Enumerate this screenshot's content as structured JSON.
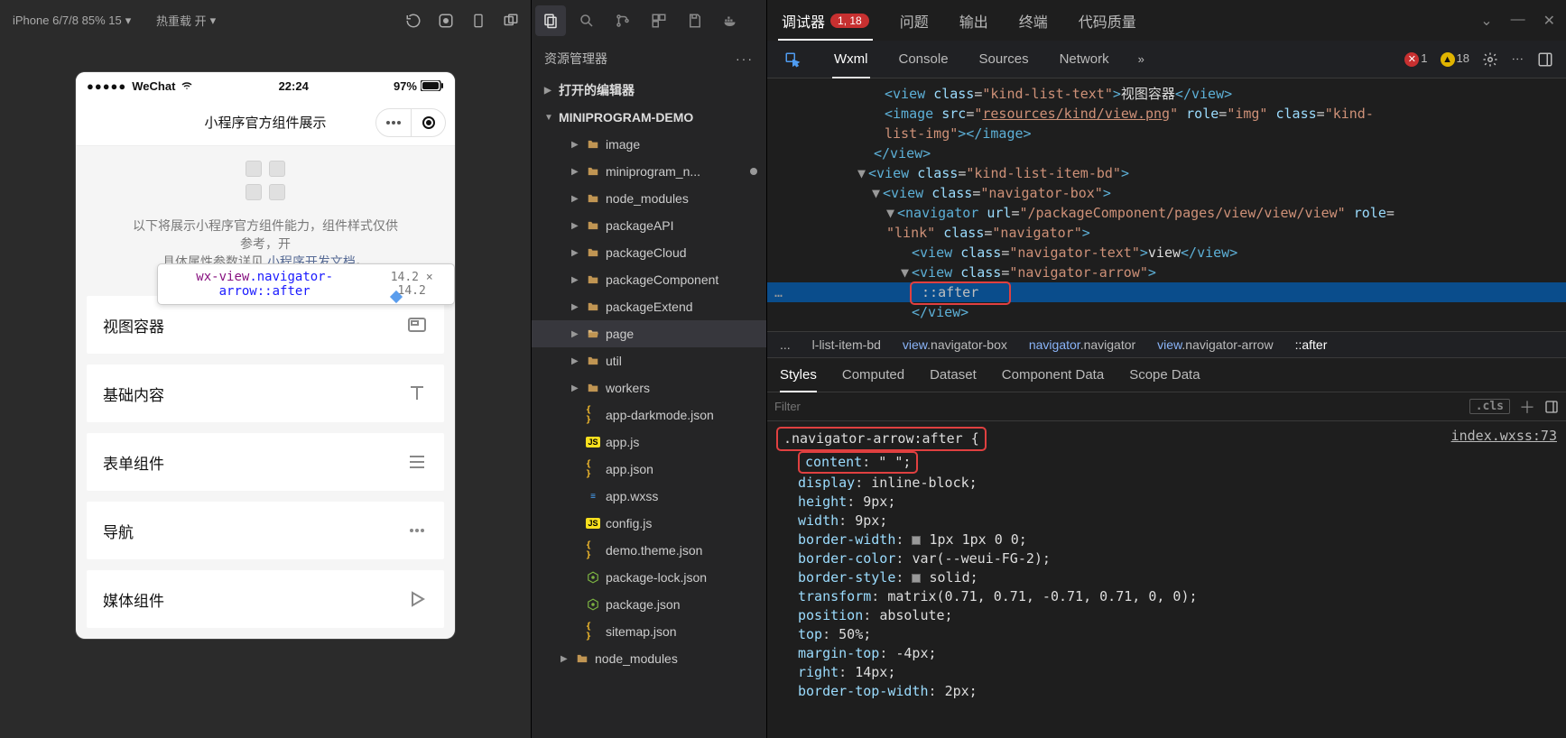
{
  "sim": {
    "device_label": "iPhone 6/7/8 85% 15",
    "reload_label": "热重载 开",
    "phone": {
      "carrier": "WeChat",
      "clock": "22:24",
      "battery": "97%",
      "nav_title": "小程序官方组件展示",
      "desc_line1": "以下将展示小程序官方组件能力，组件样式仅供",
      "desc_line2_a": "参考，开",
      "desc_line2_b": "具体属性参数详见",
      "desc_link": "小程序开发文档",
      "desc_link_tail": "。",
      "tooltip_tag": "wx-view",
      "tooltip_cls": ".navigator-arrow::after",
      "tooltip_dims": "14.2 × 14.2",
      "items": [
        {
          "label": "视图容器"
        },
        {
          "label": "基础内容"
        },
        {
          "label": "表单组件"
        },
        {
          "label": "导航"
        },
        {
          "label": "媒体组件"
        }
      ]
    }
  },
  "explorer": {
    "title": "资源管理器",
    "section_open_editors": "打开的编辑器",
    "section_project": "MINIPROGRAM-DEMO",
    "tree": [
      {
        "indent": 30,
        "kind": "folder",
        "label": "image"
      },
      {
        "indent": 30,
        "kind": "folder",
        "label": "miniprogram_n...",
        "unsaved": true
      },
      {
        "indent": 30,
        "kind": "folder",
        "label": "node_modules"
      },
      {
        "indent": 30,
        "kind": "folder",
        "label": "packageAPI"
      },
      {
        "indent": 30,
        "kind": "folder",
        "label": "packageCloud"
      },
      {
        "indent": 30,
        "kind": "folder",
        "label": "packageComponent"
      },
      {
        "indent": 30,
        "kind": "folder",
        "label": "packageExtend"
      },
      {
        "indent": 30,
        "kind": "folder_open",
        "label": "page",
        "selected": true
      },
      {
        "indent": 30,
        "kind": "folder",
        "label": "util"
      },
      {
        "indent": 30,
        "kind": "folder",
        "label": "workers"
      },
      {
        "indent": 30,
        "kind": "json",
        "label": "app-darkmode.json"
      },
      {
        "indent": 30,
        "kind": "js",
        "label": "app.js"
      },
      {
        "indent": 30,
        "kind": "json",
        "label": "app.json"
      },
      {
        "indent": 30,
        "kind": "wxss",
        "label": "app.wxss"
      },
      {
        "indent": 30,
        "kind": "js",
        "label": "config.js"
      },
      {
        "indent": 30,
        "kind": "json",
        "label": "demo.theme.json"
      },
      {
        "indent": 30,
        "kind": "npm",
        "label": "package-lock.json"
      },
      {
        "indent": 30,
        "kind": "npm",
        "label": "package.json"
      },
      {
        "indent": 30,
        "kind": "json",
        "label": "sitemap.json"
      },
      {
        "indent": 18,
        "kind": "folder",
        "label": "node_modules"
      }
    ]
  },
  "devtools": {
    "top_tabs": {
      "debugger": "调试器",
      "debugger_badge": "1, 18",
      "problems": "问题",
      "output": "输出",
      "terminal": "终端",
      "code_quality": "代码质量"
    },
    "sub_tabs": {
      "wxml": "Wxml",
      "console": "Console",
      "sources": "Sources",
      "network": "Network"
    },
    "issue_counts": {
      "errors": "1",
      "warnings": "18"
    },
    "dom": {
      "l0a": "<view class=\"kind-list-text\">",
      "l0b": "视图容器",
      "l0c": "</view>",
      "l1a": "<image src=\"",
      "l1b": "resources/kind/view.png",
      "l1c": "\" role=\"img\" class=\"kind-",
      "l1d": "list-img\"></image>",
      "l2": "</view>",
      "l3": "<view class=\"kind-list-item-bd\">",
      "l4": "<view class=\"navigator-box\">",
      "l5a": "<navigator url=\"/packageComponent/pages/view/view/view\" role=",
      "l5b": "\"link\" class=\"navigator\">",
      "l6a": "<view class=\"navigator-text\">",
      "l6b": "view",
      "l6c": "</view>",
      "l7": "<view class=\"navigator-arrow\">",
      "l8": "::after",
      "l9": "</view>"
    },
    "crumbs": {
      "c0": "...",
      "c1": "l-list-item-bd",
      "c2a": "view",
      "c2b": ".navigator-box",
      "c3a": "navigator",
      "c3b": ".navigator",
      "c4a": "view",
      "c4b": ".navigator-arrow",
      "c5": "::after"
    },
    "style_tabs": {
      "styles": "Styles",
      "computed": "Computed",
      "dataset": "Dataset",
      "component_data": "Component Data",
      "scope_data": "Scope Data"
    },
    "filter_placeholder": "Filter",
    "cls_btn": ".cls",
    "css": {
      "selector": ".navigator-arrow:after {",
      "source_ref": "index.wxss:73",
      "props": [
        {
          "name": "content",
          "value": "\" \";",
          "highlight": true
        },
        {
          "name": "display",
          "value": "inline-block;"
        },
        {
          "name": "height",
          "value": "9px;"
        },
        {
          "name": "width",
          "value": "9px;"
        },
        {
          "name": "border-width",
          "value": "1px 1px 0 0;",
          "swatch": true
        },
        {
          "name": "border-color",
          "value": "var(--weui-FG-2);"
        },
        {
          "name": "border-style",
          "value": "solid;",
          "swatch": true
        },
        {
          "name": "transform",
          "value": "matrix(0.71, 0.71, -0.71, 0.71, 0, 0);"
        },
        {
          "name": "position",
          "value": "absolute;"
        },
        {
          "name": "top",
          "value": "50%;"
        },
        {
          "name": "margin-top",
          "value": "-4px;"
        },
        {
          "name": "right",
          "value": "14px;"
        },
        {
          "name": "border-top-width",
          "value": "2px;"
        }
      ]
    }
  }
}
